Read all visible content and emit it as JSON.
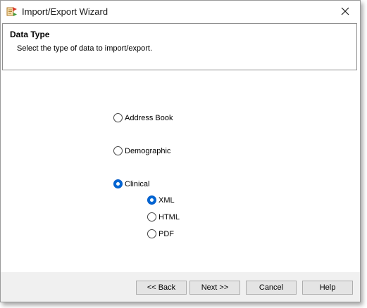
{
  "window": {
    "title": "Import/Export Wizard"
  },
  "header": {
    "title": "Data Type",
    "subtitle": "Select the type of data to import/export."
  },
  "options": {
    "address_book": {
      "label": "Address Book",
      "checked": false
    },
    "demographic": {
      "label": "Demographic",
      "checked": false
    },
    "clinical": {
      "label": "Clinical",
      "checked": true
    },
    "xml": {
      "label": "XML",
      "checked": true
    },
    "html": {
      "label": "HTML",
      "checked": false
    },
    "pdf": {
      "label": "PDF",
      "checked": false
    }
  },
  "buttons": {
    "back": "<< Back",
    "next": "Next >>",
    "cancel": "Cancel",
    "help": "Help"
  },
  "colors": {
    "accent": "#0067d4",
    "footer_bg": "#f0f0f0",
    "button_bg": "#e4e4e4"
  },
  "icons": {
    "app": "wizard-app-icon",
    "close": "close-icon"
  }
}
